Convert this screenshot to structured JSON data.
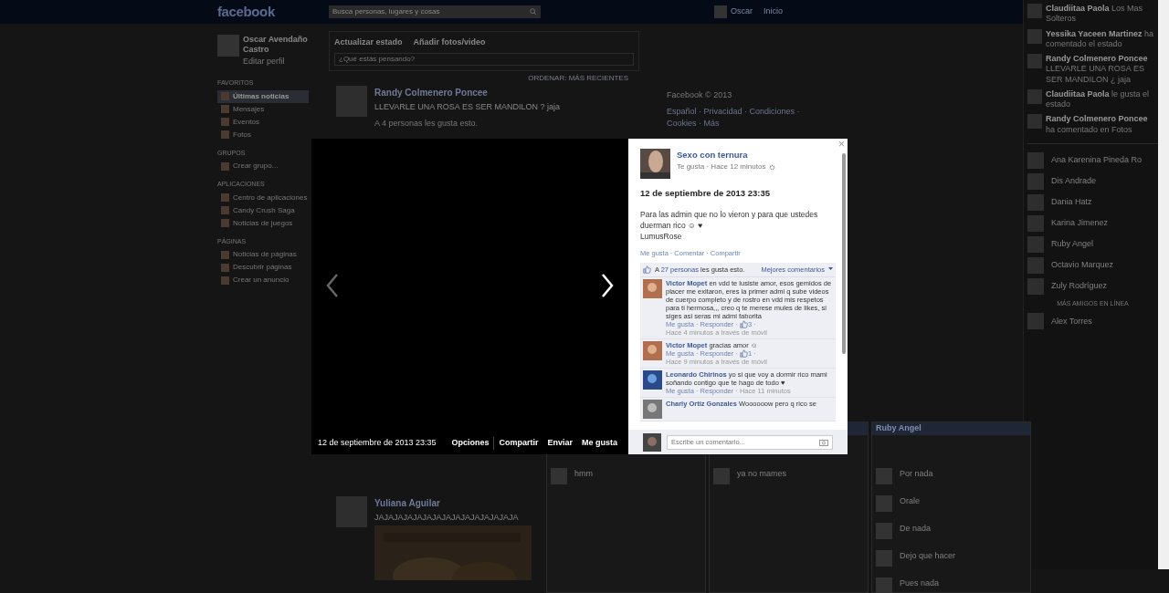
{
  "header": {
    "logo": "facebook",
    "search_placeholder": "Busca personas, lugares y cosas",
    "user": "Oscar",
    "home": "Inicio"
  },
  "sidebar": {
    "profile_name": "Oscar Avendaño Castro",
    "edit_profile": "Editar perfil",
    "sections": [
      {
        "title": "FAVORITOS",
        "items": [
          {
            "label": "Últimas noticias",
            "selected": true
          },
          {
            "label": "Mensajes",
            "selected": false
          },
          {
            "label": "Eventos",
            "selected": false
          },
          {
            "label": "Fotos",
            "selected": false
          }
        ]
      },
      {
        "title": "GRUPOS",
        "items": [
          {
            "label": "Crear grupo...",
            "selected": false
          }
        ]
      },
      {
        "title": "APLICACIONES",
        "items": [
          {
            "label": "Centro de aplicaciones",
            "selected": false
          },
          {
            "label": "Candy Crush Saga",
            "selected": false
          },
          {
            "label": "Noticias de juegos",
            "selected": false
          }
        ]
      },
      {
        "title": "PÁGINAS",
        "items": [
          {
            "label": "Noticias de páginas",
            "selected": false
          },
          {
            "label": "Descubrir páginas",
            "selected": false
          },
          {
            "label": "Crear un anuncio",
            "selected": false
          }
        ]
      }
    ]
  },
  "composer": {
    "tabs": [
      "Actualizar estado",
      "Añadir fotos/video"
    ],
    "placeholder": "¿Qué estás pensando?",
    "sort": "ORDENAR: MÁS RECIENTES"
  },
  "posts": [
    {
      "author": "Randy Colmenero Poncee",
      "text": "LLEVARLE UNA ROSA ES SER MANDILON ? jaja",
      "likes": "A 4 personas les gusta esto."
    },
    {
      "author": "Yuliana Aguilar",
      "text": "JAJAJAJAJAJAJAJAJAJAJAJAJAJAJA",
      "has_picture": true
    }
  ],
  "footer": {
    "copyright": "Facebook © 2013",
    "links": "Español · Privacidad · Condiciones · Cookies · Más"
  },
  "ticker": [
    {
      "actor": "Claudiitaa Paola",
      "text": "Los Mas Solteros"
    },
    {
      "actor": "Yessika Yaceen Martinez",
      "text": "ha comentado el estado"
    },
    {
      "actor": "Randy Colmenero Poncee",
      "text": "LLEVARLE UNA ROSA ES SER MANDILON ¿ jaja"
    },
    {
      "actor": "Claudiitaa Paola",
      "text": "le gusta el estado"
    },
    {
      "actor": "Randy Colmenero Poncee",
      "text": "ha comentado en Fotos"
    }
  ],
  "chat_list": {
    "friends": [
      "Ana Karenina Pineda Ro",
      "Dis Andrade",
      "Dania Hatz",
      "Karina Jimenez",
      "Ruby Angel",
      "Octavio Marquez",
      "Zuly Rodríguez"
    ],
    "more": "MÁS AMIGOS EN LÍNEA",
    "more_friends": [
      "Alex Torres"
    ]
  },
  "chat_windows": [
    {
      "messages": [
        "hmm"
      ]
    },
    {
      "messages": [
        "ya no mames"
      ]
    },
    {
      "title": "Ruby Angel",
      "messages": [
        "Por nada",
        "Orale",
        "De nada",
        "Dejo que hacer",
        "Pues nada"
      ]
    }
  ],
  "viewer": {
    "date": "12 de septiembre de 2013 23:35",
    "actions": [
      "Opciones",
      "Compartir",
      "Enviar",
      "Me gusta"
    ],
    "close": "×",
    "page_name": "Sexo con ternura",
    "page_meta": "Te gusta · Hace 12 minutos",
    "title": "12 de septiembre de 2013 23:35",
    "caption": "Para las admin que no lo vieron y para que ustedes duerman rico ☺ ♥",
    "caption_signature": "LumusRose",
    "post_actions": [
      "Me gusta",
      "Comentar",
      "Compartir"
    ],
    "separator": "·",
    "likes_prefix": "A",
    "likes_link": "27 personas",
    "likes_suffix": "les gusta esto.",
    "sort": "Mejores comentarios",
    "comments": [
      {
        "author": "Victor Mopet",
        "text": "en vdd te lusiste amor, esos gemidos de placer me exitaron, eres la primer admi q sube videos de cuerpo completo y de rostro en vdd mis respetos para ti hermosa,,, creo q te merese mules de likes, si siges asi seras mi admi faborita",
        "actions": [
          "Me gusta",
          "Responder"
        ],
        "like_count": "3",
        "time": "Hace 4 minutos a través de móvil"
      },
      {
        "author": "Victor Mopet",
        "text": "gracias amor ☺",
        "actions": [
          "Me gusta",
          "Responder"
        ],
        "like_count": "1",
        "time": "Hace 9 minutos a través de móvil"
      },
      {
        "author": "Leonardo Chirinos",
        "text": "yo si que voy a dormir rico mami soñando contigo que te hago de todo ♥",
        "actions": [
          "Me gusta",
          "Responder"
        ],
        "time": "Hace 11 minutos"
      },
      {
        "author": "Charly Ortiz Gonzales",
        "text": "Woooooow pero q rico se"
      }
    ],
    "comment_placeholder": "Escribe un comentario..."
  }
}
